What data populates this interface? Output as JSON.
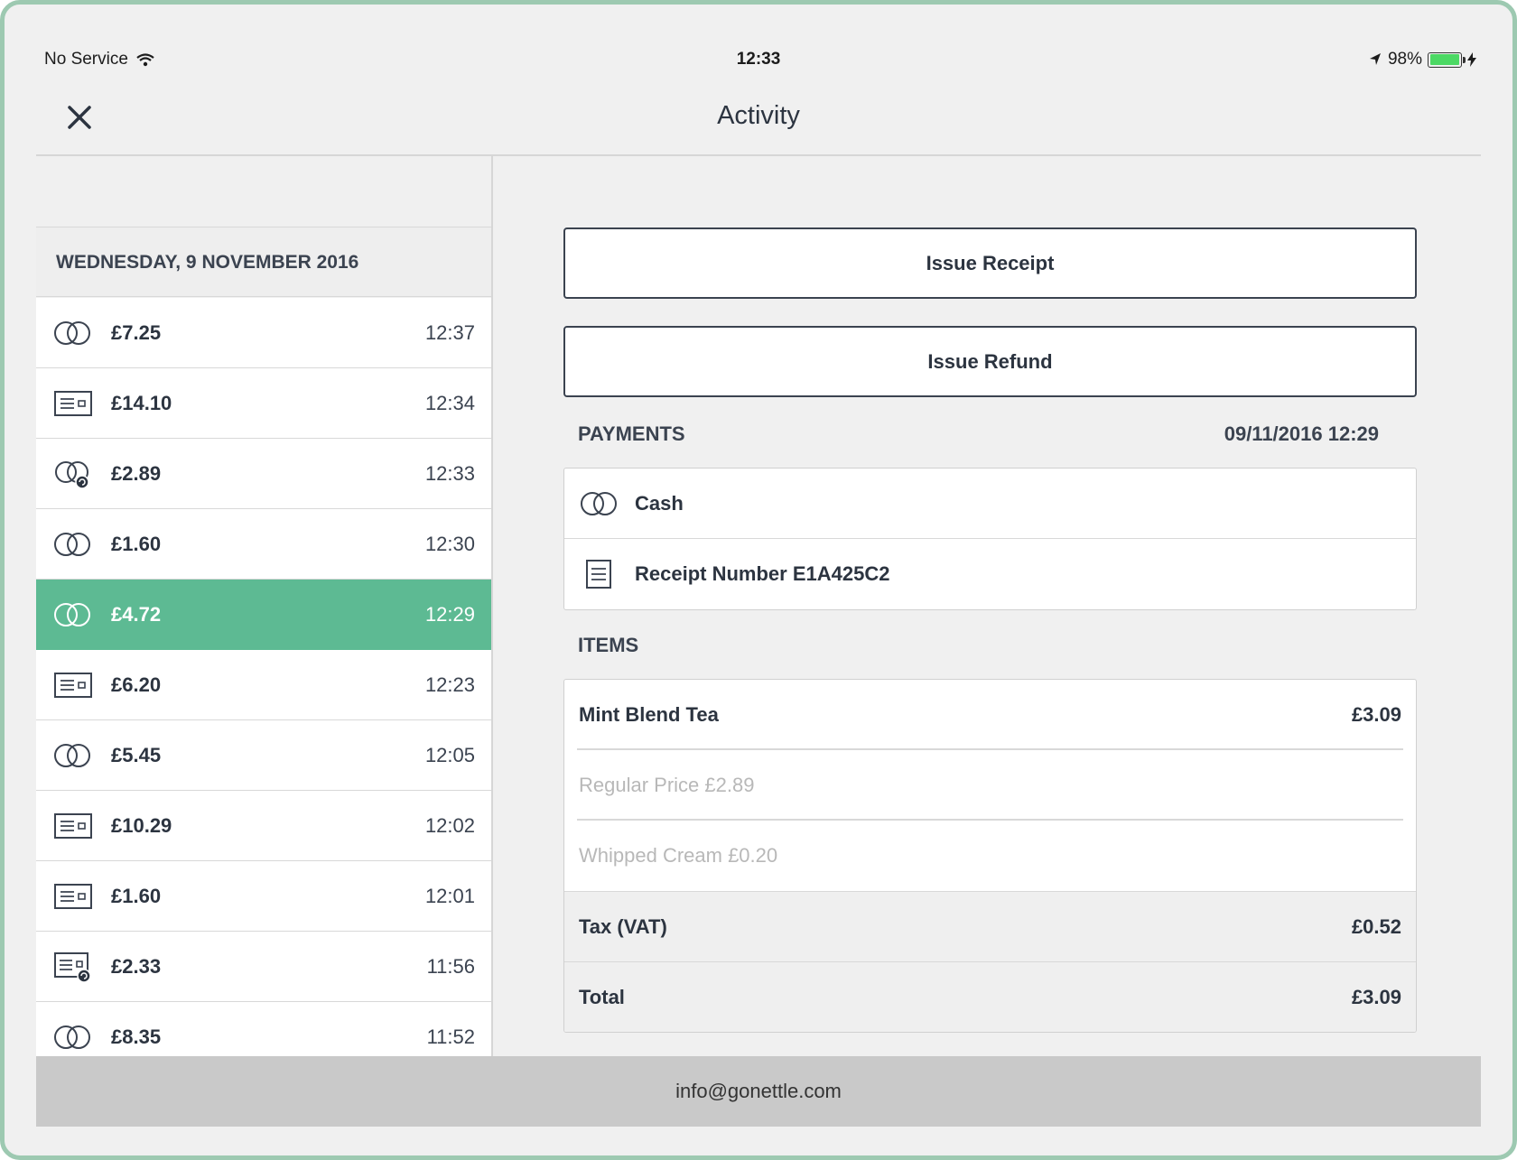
{
  "status_bar": {
    "carrier": "No Service",
    "time": "12:33",
    "battery": "98%",
    "battery_level": 0.98
  },
  "nav": {
    "title": "Activity",
    "close_icon": "close-icon"
  },
  "list": {
    "date_header": "WEDNESDAY, 9 NOVEMBER 2016",
    "transactions": [
      {
        "icon": "cash-icon",
        "amount": "£7.25",
        "time": "12:37",
        "selected": false
      },
      {
        "icon": "card-icon",
        "amount": "£14.10",
        "time": "12:34",
        "selected": false
      },
      {
        "icon": "cash-refund-icon",
        "amount": "£2.89",
        "time": "12:33",
        "selected": false
      },
      {
        "icon": "cash-icon",
        "amount": "£1.60",
        "time": "12:30",
        "selected": false
      },
      {
        "icon": "cash-icon",
        "amount": "£4.72",
        "time": "12:29",
        "selected": true
      },
      {
        "icon": "card-icon",
        "amount": "£6.20",
        "time": "12:23",
        "selected": false
      },
      {
        "icon": "cash-icon",
        "amount": "£5.45",
        "time": "12:05",
        "selected": false
      },
      {
        "icon": "card-icon",
        "amount": "£10.29",
        "time": "12:02",
        "selected": false
      },
      {
        "icon": "card-icon",
        "amount": "£1.60",
        "time": "12:01",
        "selected": false
      },
      {
        "icon": "card-refund-icon",
        "amount": "£2.33",
        "time": "11:56",
        "selected": false
      },
      {
        "icon": "cash-icon",
        "amount": "£8.35",
        "time": "11:52",
        "selected": false
      }
    ]
  },
  "detail": {
    "issue_receipt_label": "Issue Receipt",
    "issue_refund_label": "Issue Refund",
    "payments_label": "PAYMENTS",
    "payments_datetime": "09/11/2016 12:29",
    "payment_method": "Cash",
    "receipt_number": "Receipt Number E1A425C2",
    "items_label": "ITEMS",
    "items": [
      {
        "name": "Mint Blend Tea",
        "price": "£3.09"
      }
    ],
    "modifiers": [
      "Regular Price £2.89",
      "Whipped Cream £0.20"
    ],
    "tax_label": "Tax (VAT)",
    "tax_value": "£0.52",
    "total_label": "Total",
    "total_value": "£3.09"
  },
  "footer": {
    "email": "info@gonettle.com"
  },
  "colors": {
    "accent": "#5dba93",
    "frame": "#9dc9b1",
    "background": "#f0f0f0",
    "text": "#2c3440"
  }
}
